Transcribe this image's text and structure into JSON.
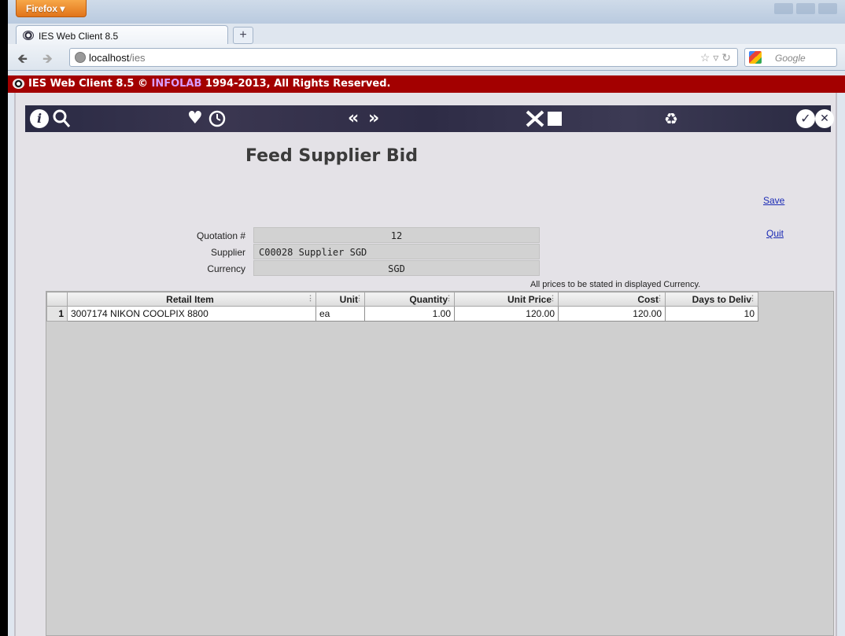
{
  "browser": {
    "menu_label": "Firefox ▾",
    "tab_title": "IES Web Client 8.5",
    "new_tab": "+",
    "url_host": "localhost",
    "url_path": "/ies",
    "search_placeholder": "Google",
    "back_icon": "back-arrow-icon",
    "forward_icon": "forward-arrow-icon"
  },
  "app_header": {
    "prefix": "IES Web Client 8.5 © ",
    "brand": "INFOLAB",
    "suffix": " 1994-2013, All Rights Reserved."
  },
  "toolbar": {
    "info": "i",
    "nav_prev": "«",
    "nav_next": "»",
    "icons": [
      "info-icon",
      "search-icon",
      "heart-icon",
      "clock-icon",
      "previous-icon",
      "next-icon",
      "tools-icon",
      "stop-icon",
      "recycle-icon",
      "check-icon",
      "close-icon"
    ]
  },
  "page": {
    "title": "Feed Supplier Bid",
    "save_label": "Save",
    "quit_label": "Quit",
    "note": "All prices to be stated in displayed Currency."
  },
  "fields": {
    "quotation_label": "Quotation #",
    "quotation_value": "12",
    "supplier_label": "Supplier",
    "supplier_value": "C00028 Supplier SGD",
    "currency_label": "Currency",
    "currency_value": "SGD"
  },
  "grid": {
    "columns": [
      "Retail Item",
      "Unit",
      "Quantity",
      "Unit Price",
      "Cost",
      "Days to Deliv"
    ],
    "rows": [
      {
        "num": "1",
        "item": "3007174 NIKON COOLPIX 8800",
        "unit": "ea",
        "quantity": "1.00",
        "unit_price": "120.00",
        "cost": "120.00",
        "days": "10"
      }
    ]
  },
  "colors": {
    "header_red": "#a30000",
    "toolbar_dark": "#2a2a44",
    "link_blue": "#1a2ab5"
  }
}
